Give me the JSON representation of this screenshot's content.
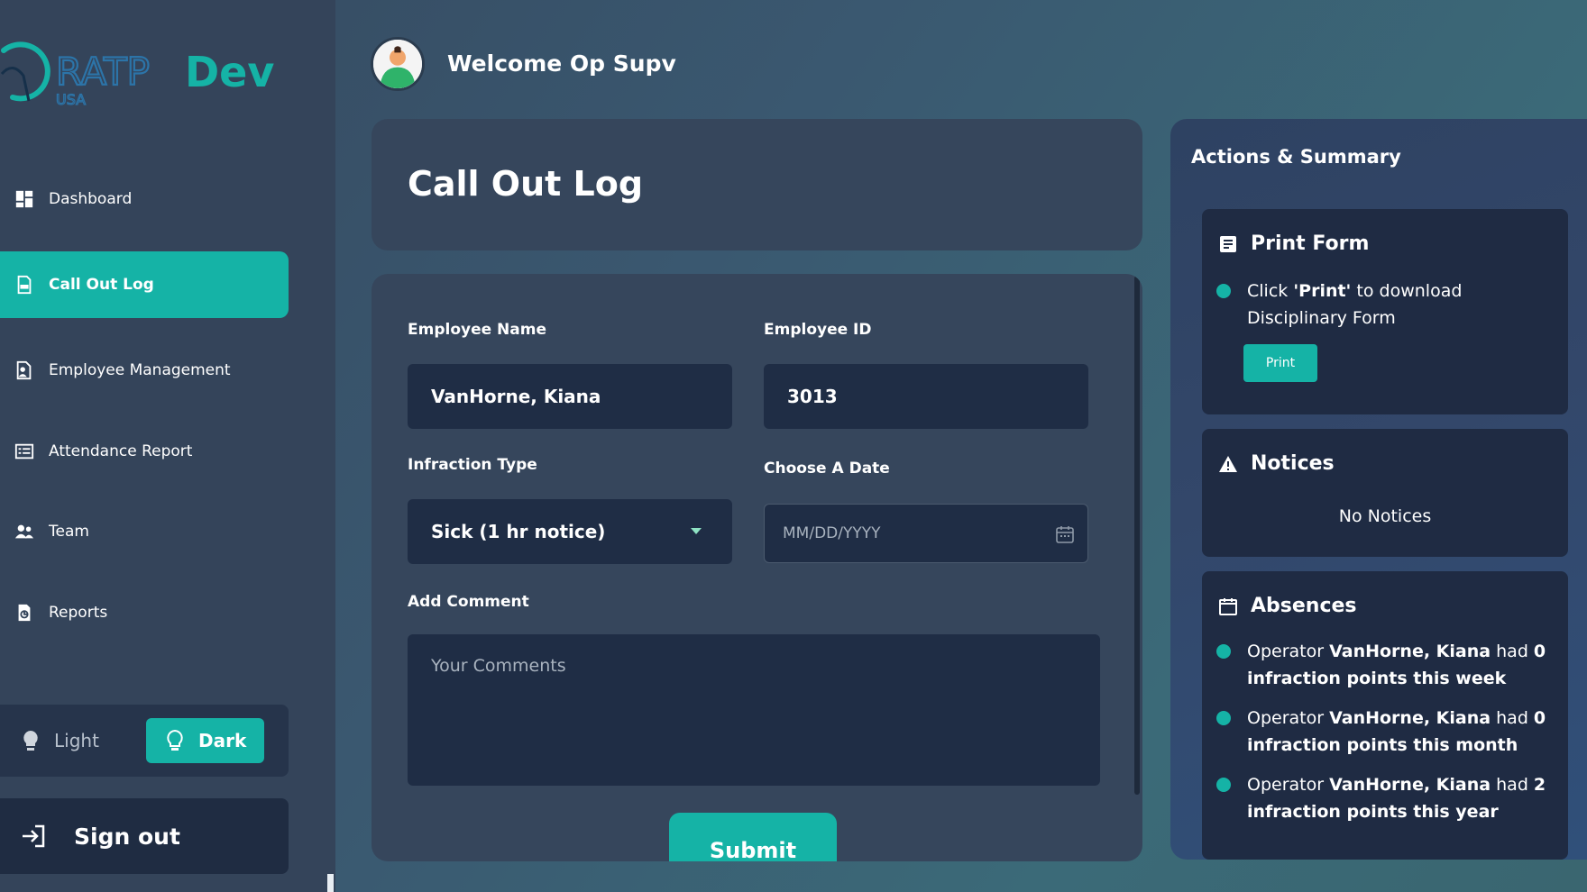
{
  "brand": {
    "logo_main": "RATP",
    "logo_dev": "Dev",
    "logo_sub": "USA"
  },
  "sidebar": {
    "items": [
      {
        "label": "Dashboard",
        "icon": "dashboard-icon"
      },
      {
        "label": "Call Out Log",
        "icon": "log-icon",
        "active": true
      },
      {
        "label": "Employee Management",
        "icon": "employee-icon"
      },
      {
        "label": "Attendance Report",
        "icon": "attendance-icon"
      },
      {
        "label": "Team",
        "icon": "team-icon"
      },
      {
        "label": "Reports",
        "icon": "reports-icon"
      }
    ],
    "theme": {
      "light_label": "Light",
      "dark_label": "Dark",
      "selected": "Dark"
    },
    "signout_label": "Sign out"
  },
  "header": {
    "welcome": "Welcome Op Supv"
  },
  "page": {
    "title": "Call Out Log"
  },
  "form": {
    "employee_name_label": "Employee Name",
    "employee_name_value": "VanHorne, Kiana",
    "employee_id_label": "Employee ID",
    "employee_id_value": "3013",
    "infraction_type_label": "Infraction Type",
    "infraction_type_value": "Sick (1 hr notice)",
    "date_label": "Choose A Date",
    "date_placeholder": "MM/DD/YYYY",
    "comment_label": "Add Comment",
    "comment_placeholder": "Your Comments",
    "submit_label": "Submit"
  },
  "summary": {
    "title": "Actions & Summary",
    "print_form": {
      "title": "Print Form",
      "text_pre": "Click ",
      "text_bold": "'Print'",
      "text_post": " to download Disciplinary Form",
      "button_label": "Print"
    },
    "notices": {
      "title": "Notices",
      "empty_text": "No Notices"
    },
    "absences": {
      "title": "Absences",
      "items": [
        {
          "pre": "Operator ",
          "name": "VanHorne, Kiana",
          "mid": " had ",
          "points": "0 infraction points this week"
        },
        {
          "pre": "Operator ",
          "name": "VanHorne, Kiana",
          "mid": " had ",
          "points": "0 infraction points this month"
        },
        {
          "pre": "Operator ",
          "name": "VanHorne, Kiana",
          "mid": " had ",
          "points": "2 infraction points this year"
        }
      ]
    }
  },
  "colors": {
    "accent": "#15b3a6",
    "sidebar_bg": "#34445a",
    "card_bg": "#36465c",
    "field_bg": "#1f2d45"
  }
}
